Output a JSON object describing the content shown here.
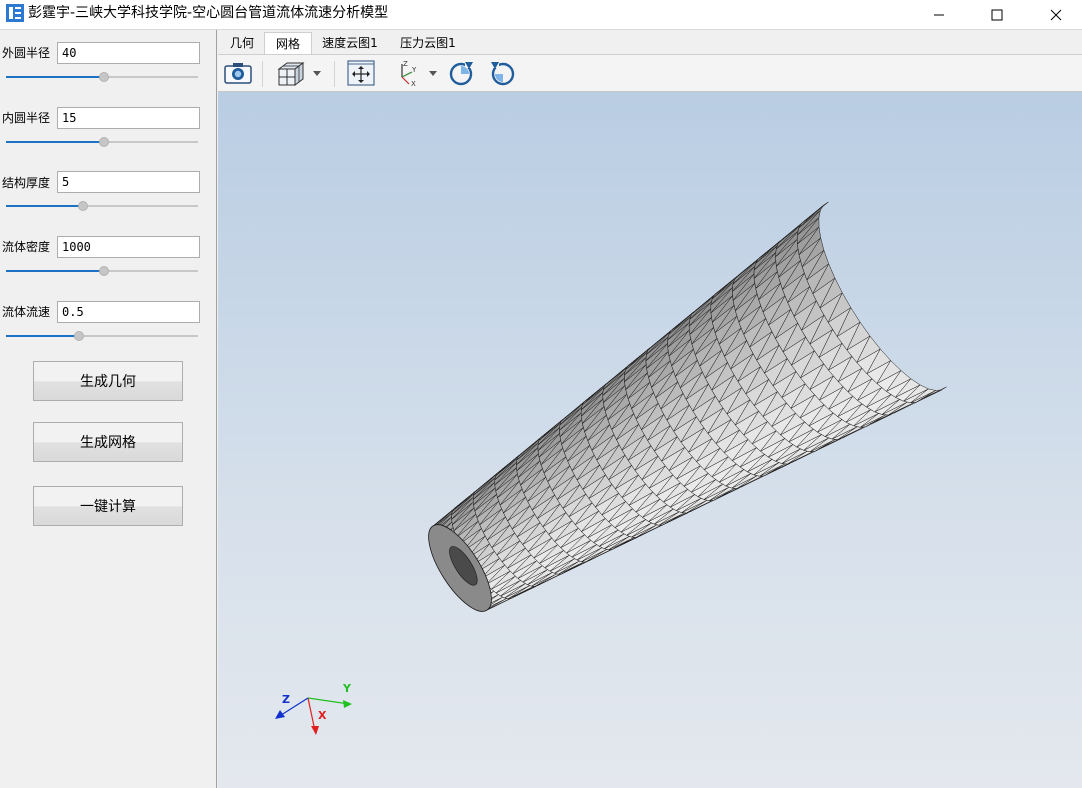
{
  "window": {
    "title": "彭霆宇-三峡大学科技学院-空心圆台管道流体流速分析模型",
    "icon": "app-logo-icon",
    "controls": [
      "minimize-icon",
      "maximize-icon",
      "close-icon"
    ]
  },
  "params": [
    {
      "label": "外圆半径",
      "value": "40",
      "slider_fraction": 0.51
    },
    {
      "label": "内圆半径",
      "value": "15",
      "slider_fraction": 0.51
    },
    {
      "label": "结构厚度",
      "value": "5",
      "slider_fraction": 0.4
    },
    {
      "label": "流体密度",
      "value": "1000",
      "slider_fraction": 0.51
    },
    {
      "label": "流体流速",
      "value": "0.5",
      "slider_fraction": 0.38
    }
  ],
  "buttons": {
    "generate_geometry": "生成几何",
    "generate_mesh": "生成网格",
    "compute": "一键计算"
  },
  "tabs": [
    {
      "label": "几何",
      "active": false
    },
    {
      "label": "网格",
      "active": true
    },
    {
      "label": "速度云图1",
      "active": false
    },
    {
      "label": "压力云图1",
      "active": false
    }
  ],
  "toolbar": {
    "icons": [
      "camera-icon",
      "view-cube-icon",
      "fit-all-icon",
      "axis-orientation-icon",
      "rotate-clockwise-icon",
      "rotate-counterclockwise-icon"
    ]
  },
  "axes": {
    "x": "X",
    "y": "Y",
    "z": "Z"
  },
  "colors": {
    "slider_fill": "#1e72c6",
    "axis_x": "#e02020",
    "axis_y": "#20c020",
    "axis_z": "#1030d0",
    "viewport_top": "#b9cde3",
    "viewport_bottom": "#e4e8ee"
  }
}
